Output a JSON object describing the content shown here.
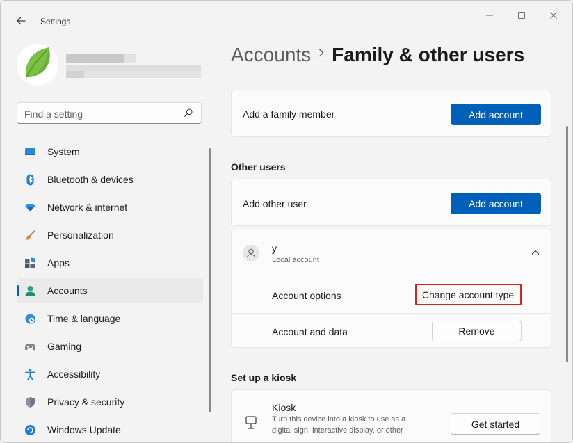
{
  "window": {
    "title": "Settings"
  },
  "sidebar": {
    "search_placeholder": "Find a setting",
    "items": [
      {
        "label": "System",
        "icon": "system-icon"
      },
      {
        "label": "Bluetooth & devices",
        "icon": "bluetooth-icon"
      },
      {
        "label": "Network & internet",
        "icon": "wifi-icon"
      },
      {
        "label": "Personalization",
        "icon": "brush-icon"
      },
      {
        "label": "Apps",
        "icon": "apps-icon"
      },
      {
        "label": "Accounts",
        "icon": "accounts-icon",
        "selected": true
      },
      {
        "label": "Time & language",
        "icon": "clock-globe-icon"
      },
      {
        "label": "Gaming",
        "icon": "gamepad-icon"
      },
      {
        "label": "Accessibility",
        "icon": "accessibility-icon"
      },
      {
        "label": "Privacy & security",
        "icon": "shield-icon"
      },
      {
        "label": "Windows Update",
        "icon": "windows-update-icon"
      }
    ]
  },
  "breadcrumb": {
    "parent": "Accounts",
    "current": "Family & other users"
  },
  "family": {
    "label": "Add a family member",
    "button": "Add account"
  },
  "other_users": {
    "title": "Other users",
    "add_label": "Add other user",
    "add_button": "Add account",
    "user": {
      "name": "y",
      "type": "Local account",
      "options_label": "Account options",
      "change_button": "Change account type",
      "data_label": "Account and data",
      "remove_button": "Remove"
    }
  },
  "kiosk": {
    "title": "Set up a kiosk",
    "name": "Kiosk",
    "description_line1": "Turn this device into a kiosk to use as a",
    "description_line2": "digital sign, interactive display, or other",
    "button": "Get started"
  },
  "colors": {
    "accent": "#005fb8",
    "highlight": "#d8211c",
    "background": "#f3f3f3"
  }
}
